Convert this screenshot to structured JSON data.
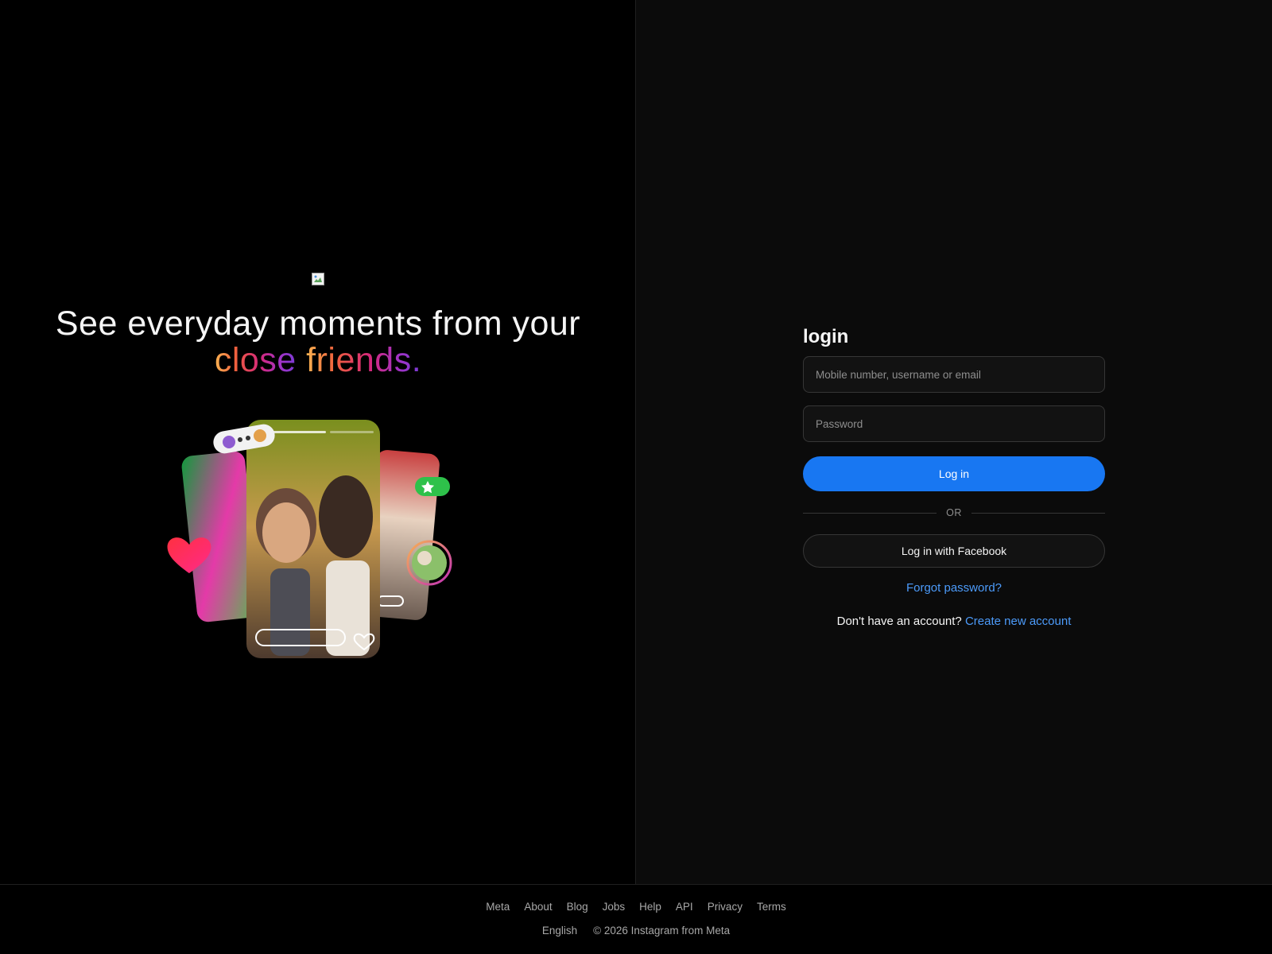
{
  "hero": {
    "headline_line1": "See everyday moments from your",
    "headline_word1": "close",
    "headline_word2": "friends."
  },
  "login": {
    "title": "login",
    "username_placeholder": "Mobile number, username or email",
    "password_placeholder": "Password",
    "login_button": "Log in",
    "or_text": "OR",
    "facebook_button": "Log in with Facebook",
    "forgot_password": "Forgot password?",
    "no_account_text": "Don't have an account?",
    "create_account": "Create new account"
  },
  "footer": {
    "links": [
      "Meta",
      "About",
      "Blog",
      "Jobs",
      "Help",
      "API",
      "Privacy",
      "Terms"
    ],
    "language": "English",
    "copyright": "© 2026 Instagram from Meta"
  },
  "colors": {
    "primary_button": "#1877f2",
    "link": "#4c9bfa",
    "left_bg": "#000000",
    "right_bg": "#0b0b0b"
  },
  "icons": [
    "broken-image-icon",
    "heart-icon",
    "star-icon"
  ]
}
